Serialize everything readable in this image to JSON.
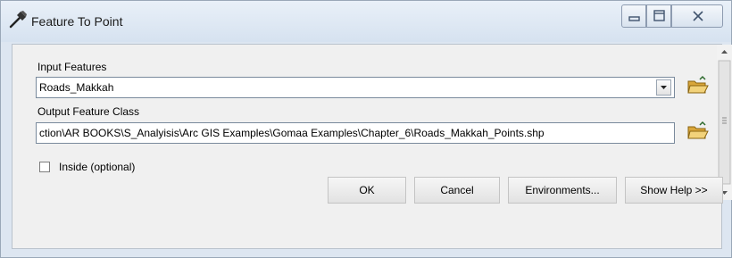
{
  "window": {
    "title": "Feature To Point"
  },
  "titlebar_icons": {
    "app": "hammer-icon",
    "minimize": "minimize-icon",
    "maximize": "maximize-icon",
    "close": "close-icon"
  },
  "form": {
    "input_features_label": "Input Features",
    "input_features_value": "Roads_Makkah",
    "output_class_label": "Output Feature Class",
    "output_class_value": "ction\\AR BOOKS\\S_Analyisis\\Arc GIS Examples\\Gomaa Examples\\Chapter_6\\Roads_Makkah_Points.shp",
    "inside_label": "Inside (optional)",
    "inside_checked": false
  },
  "buttons": {
    "ok": "OK",
    "cancel": "Cancel",
    "environments": "Environments...",
    "show_help": "Show Help >>"
  },
  "colors": {
    "titlebar": "#dbe6f2",
    "client": "#f0f0f0",
    "folder": "#e8c15a"
  }
}
